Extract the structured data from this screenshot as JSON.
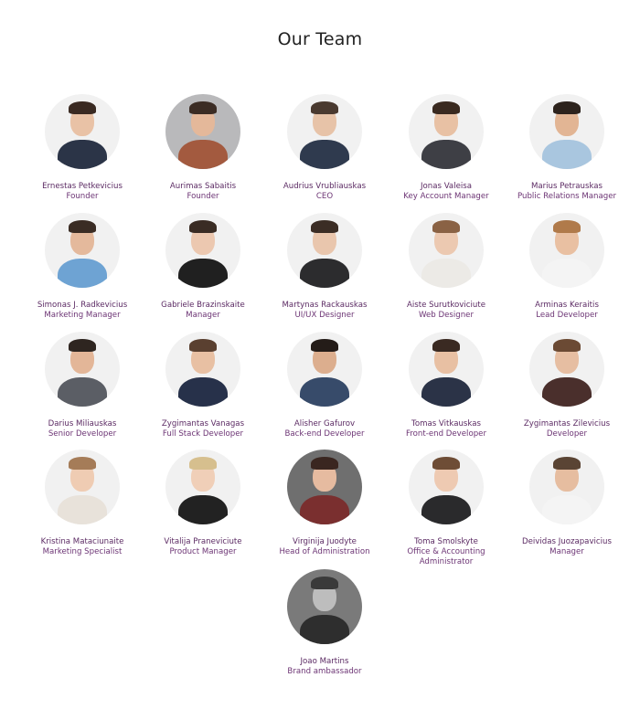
{
  "header": {
    "title": "Our Team"
  },
  "team": [
    {
      "name": "Ernestas Petkevicius",
      "role": "Founder",
      "bg": "#f1f1f1",
      "skin": "#e9c2a6",
      "hair": "#3a2a22",
      "shirt": "#2b3447"
    },
    {
      "name": "Aurimas Sabaitis",
      "role": "Founder",
      "bg": "#b9b9bb",
      "skin": "#e4b89a",
      "hair": "#3b2c24",
      "shirt": "#a35a3f"
    },
    {
      "name": "Audrius Vrubliauskas",
      "role": "CEO",
      "bg": "#f1f1f1",
      "skin": "#e7c3a8",
      "hair": "#4a3a30",
      "shirt": "#2f3a4e"
    },
    {
      "name": "Jonas Valeisa",
      "role": "Key Account Manager",
      "bg": "#f1f1f1",
      "skin": "#e8c1a4",
      "hair": "#3a2a20",
      "shirt": "#3e3f45"
    },
    {
      "name": "Marius Petrauskas",
      "role": "Public Relations Manager",
      "bg": "#f1f1f1",
      "skin": "#e2b594",
      "hair": "#2d231d",
      "shirt": "#a9c6df"
    },
    {
      "name": "Simonas J. Radkevicius",
      "role": "Marketing Manager",
      "bg": "#f1f1f1",
      "skin": "#e4b99c",
      "hair": "#3a2c24",
      "shirt": "#6ea3d3"
    },
    {
      "name": "Gabriele Brazinskaite",
      "role": "Manager",
      "bg": "#f1f1f1",
      "skin": "#ecc8b0",
      "hair": "#3a2c24",
      "shirt": "#202020"
    },
    {
      "name": "Martynas Rackauskas",
      "role": "UI/UX Designer",
      "bg": "#f1f1f1",
      "skin": "#e9c6ad",
      "hair": "#3b2d25",
      "shirt": "#2c2c2e"
    },
    {
      "name": "Aiste Surutkoviciute",
      "role": "Web Designer",
      "bg": "#f1f1f1",
      "skin": "#ecc9b1",
      "hair": "#8a6244",
      "shirt": "#eceae6"
    },
    {
      "name": "Arminas Keraitis",
      "role": "Lead Developer",
      "bg": "#f1f1f1",
      "skin": "#e9c0a2",
      "hair": "#b07a4a",
      "shirt": "#f4f4f4"
    },
    {
      "name": "Darius Miliauskas",
      "role": "Senior Developer",
      "bg": "#f1f1f1",
      "skin": "#e3b698",
      "hair": "#2e2520",
      "shirt": "#5b5e65"
    },
    {
      "name": "Zygimantas Vanagas",
      "role": "Full Stack Developer",
      "bg": "#f1f1f1",
      "skin": "#e8c0a3",
      "hair": "#5a4030",
      "shirt": "#27314a"
    },
    {
      "name": "Alisher Gafurov",
      "role": "Back-end Developer",
      "bg": "#f1f1f1",
      "skin": "#dcae8e",
      "hair": "#241c18",
      "shirt": "#374b6a"
    },
    {
      "name": "Tomas Vitkauskas",
      "role": "Front-end Developer",
      "bg": "#f1f1f1",
      "skin": "#e8c0a3",
      "hair": "#3a2a22",
      "shirt": "#2b3347"
    },
    {
      "name": "Zygimantas Zilevicius",
      "role": "Developer",
      "bg": "#f1f1f1",
      "skin": "#e6bea2",
      "hair": "#6b4a34",
      "shirt": "#4a2f2c"
    },
    {
      "name": "Kristina Mataciunaite",
      "role": "Marketing Specialist",
      "bg": "#f1f1f1",
      "skin": "#efccb3",
      "hair": "#a57c58",
      "shirt": "#e8e2da"
    },
    {
      "name": "Vitalija Praneviciute",
      "role": "Product Manager",
      "bg": "#f1f1f1",
      "skin": "#f0cfb8",
      "hair": "#d6bf8e",
      "shirt": "#222222"
    },
    {
      "name": "Virginija Juodyte",
      "role": "Head of Administration",
      "bg": "#6f6f6f",
      "skin": "#e6bba0",
      "hair": "#3a2620",
      "shirt": "#7a2f2f"
    },
    {
      "name": "Toma Smolskyte",
      "role": "Office & Accounting Administrator",
      "bg": "#f1f1f1",
      "skin": "#eecab2",
      "hair": "#6e4d36",
      "shirt": "#2a2a2c"
    },
    {
      "name": "Deividas Juozapavicius",
      "role": "Manager",
      "bg": "#f1f1f1",
      "skin": "#e6bda0",
      "hair": "#5a4434",
      "shirt": "#f4f4f4"
    },
    {
      "name": "Joao Martins",
      "role": "Brand ambassador",
      "bg": "#7a7a7a",
      "skin": "#bdbdbd",
      "hair": "#3a3a3a",
      "shirt": "#2e2e2e"
    }
  ]
}
